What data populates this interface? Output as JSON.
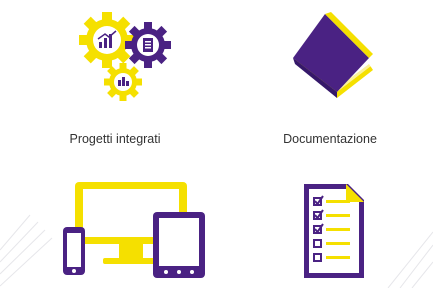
{
  "tiles": [
    {
      "label": "Progetti integrati",
      "icon": "gears-icon"
    },
    {
      "label": "Documentazione",
      "icon": "book-icon"
    },
    {
      "label": "",
      "icon": "devices-icon"
    },
    {
      "label": "",
      "icon": "checklist-icon"
    }
  ],
  "colors": {
    "yellow": "#f5e000",
    "purple": "#4a2283",
    "text": "#333333"
  }
}
